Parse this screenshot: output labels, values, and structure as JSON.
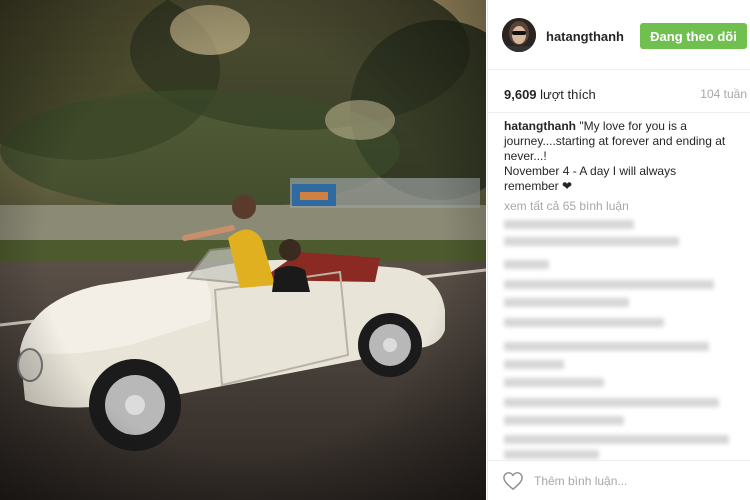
{
  "post": {
    "username": "hatangthanh",
    "follow_label": "Đang theo dõi",
    "likes_count": "9,609",
    "likes_label": "lượt thích",
    "time_ago": "104 tuần",
    "caption_user": "hatangthanh",
    "caption_line1": "\"My love for you is a journey....starting at forever and ending at never...!",
    "caption_line2": "November 4 - A day I will always remember ❤",
    "view_all_comments": "xem tất cả 65 bình luận",
    "comment_placeholder": "Thêm bình luận..."
  },
  "icons": {
    "like": "heart-icon",
    "avatar": "avatar"
  },
  "colors": {
    "follow_button": "#70c050",
    "muted_text": "#a5a7aa"
  }
}
